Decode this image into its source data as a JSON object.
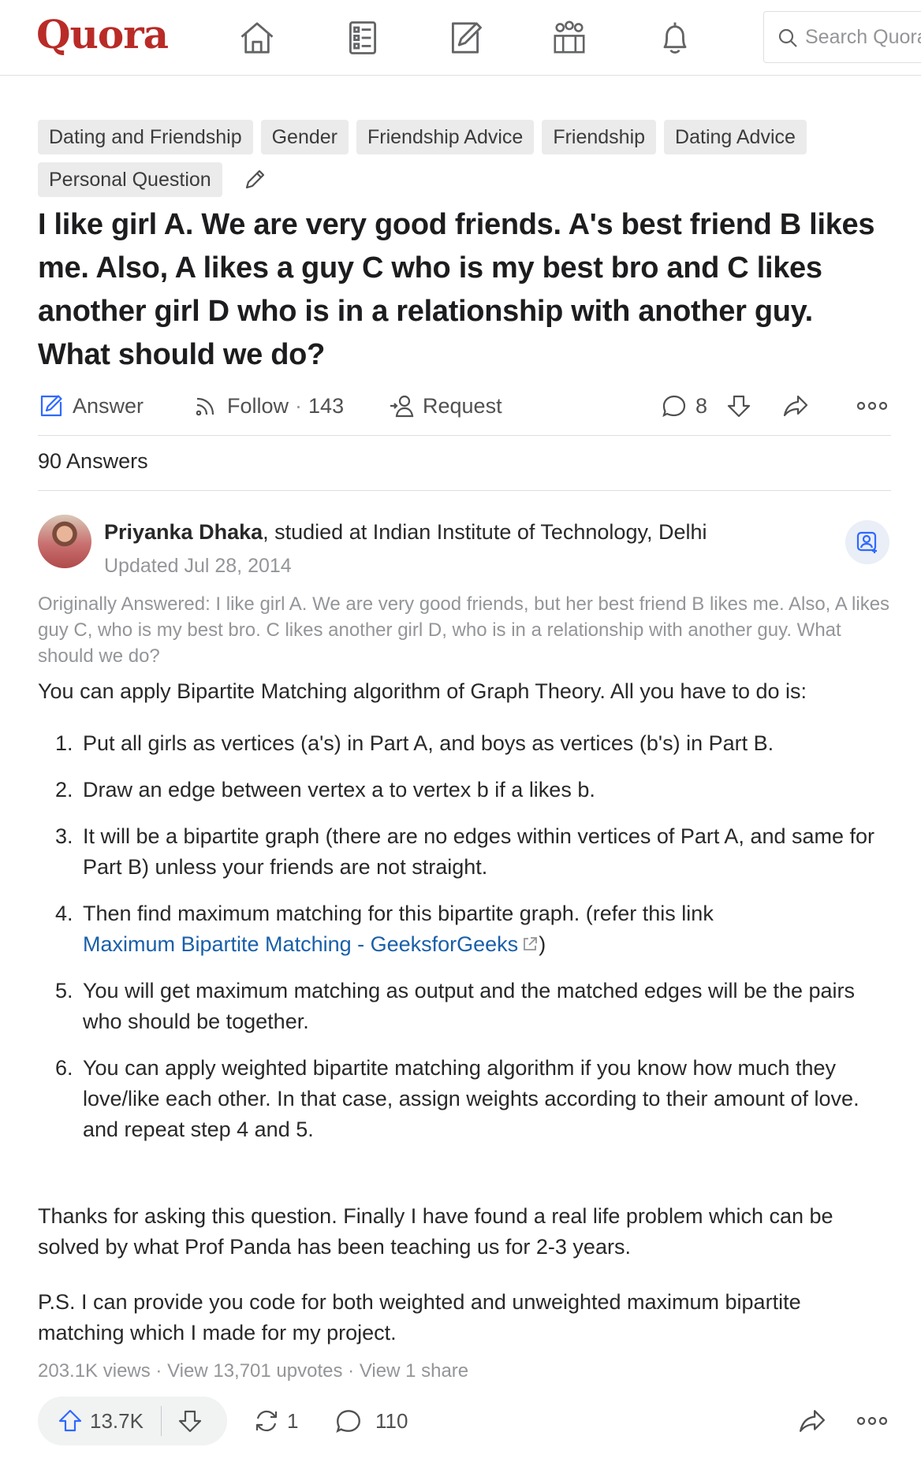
{
  "header": {
    "logo": "Quora",
    "nav_icons": [
      "home-icon",
      "following-icon",
      "answer-icon",
      "spaces-icon",
      "notifications-icon"
    ],
    "search_placeholder": "Search Quora"
  },
  "topics": [
    "Dating and Friendship",
    "Gender",
    "Friendship Advice",
    "Friendship",
    "Dating Advice",
    "Personal Question"
  ],
  "question": {
    "title": "I like girl A. We are very good friends. A's best friend B likes me. Also, A likes a guy C who is my best bro and C likes another girl D who is in a relationship with another guy. What should we do?"
  },
  "question_actions": {
    "answer": "Answer",
    "follow": "Follow",
    "follow_count": "143",
    "request": "Request",
    "comments": "8"
  },
  "answers_count": "90 Answers",
  "answer": {
    "author_name": "Priyanka Dhaka",
    "author_credential": ", studied at Indian Institute of Technology, Delhi",
    "updated": "Updated Jul 28, 2014",
    "originally_answered": "Originally Answered: I like girl A. We are very good friends, but her best friend B likes me. Also, A likes guy C, who is my best bro. C likes another girl D, who is in a relationship with another guy. What should we do?",
    "intro": "You can apply Bipartite Matching algorithm of Graph Theory. All you have to do is:",
    "steps": [
      {
        "num": "1.",
        "text": "Put all girls as vertices (a's) in Part A, and boys as vertices (b's) in Part B."
      },
      {
        "num": "2.",
        "text": "Draw an edge between vertex a to vertex b if a likes b."
      },
      {
        "num": "3.",
        "text": "It will be a bipartite graph (there are no edges within vertices of Part A, and same for Part B) unless your friends are not straight."
      },
      {
        "num": "4.",
        "text": "Then find maximum matching for this bipartite graph. (refer this link",
        "link": "Maximum Bipartite Matching - GeeksforGeeks",
        "after": ")"
      },
      {
        "num": "5.",
        "text": "You will get maximum matching as output and the matched edges will be the pairs who should be together."
      },
      {
        "num": "6.",
        "text": "You can apply weighted bipartite matching algorithm if you know how much they love/like each other. In that case, assign weights according to their amount of love. and repeat step 4 and 5."
      }
    ],
    "thanks": "Thanks for asking this question. Finally I have found a real life problem which can be solved by what Prof Panda has been teaching us for 2-3 years.",
    "ps": "P.S. I can provide you code for both weighted and unweighted maximum bipartite matching which I made for my project.",
    "stats": {
      "views": "203.1K views",
      "upvotes": "View 13,701 upvotes",
      "shares": "View 1 share",
      "separator": "·"
    },
    "footer": {
      "upvotes": "13.7K",
      "reshares": "1",
      "comments": "110"
    }
  },
  "colors": {
    "brand": "#b92b27",
    "link": "#195faa",
    "muted": "#939598",
    "text": "#282829"
  }
}
